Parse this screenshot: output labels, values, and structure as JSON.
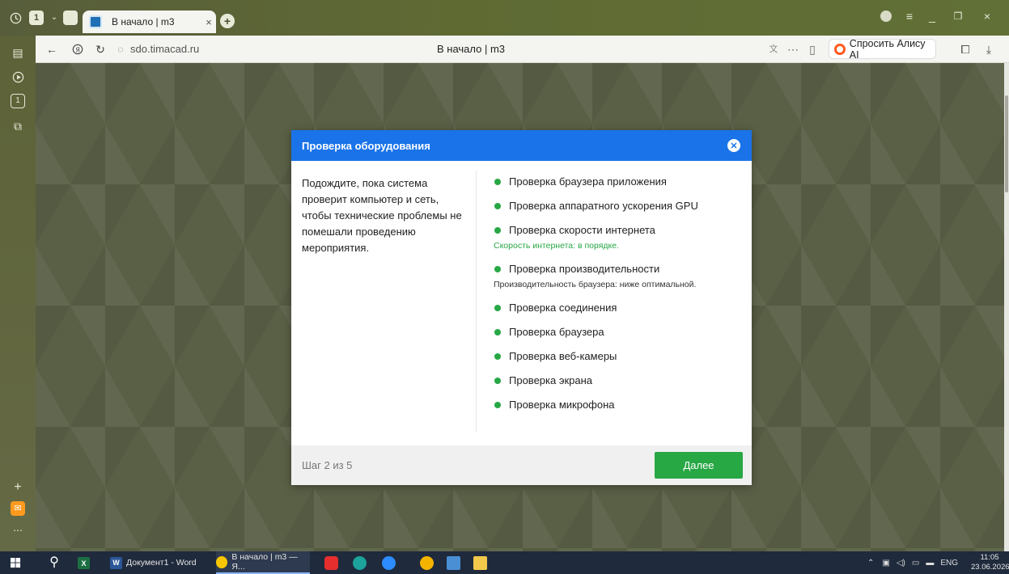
{
  "browser": {
    "tab_count": "1",
    "tab_title": "В начало | m3",
    "url": "sdo.timacad.ru",
    "page_title": "В начало | m3",
    "alice_button": "Спросить Алису AI"
  },
  "dialog": {
    "title": "Проверка оборудования",
    "description": "Подождите, пока система проверит компьютер и сеть, чтобы технические проблемы не помешали проведению мероприятия.",
    "checks": [
      {
        "name": "Проверка браузера приложения",
        "note": "",
        "status_color": "#28a745"
      },
      {
        "name": "Проверка аппаратного ускорения GPU",
        "note": "",
        "status_color": "#28a745"
      },
      {
        "name": "Проверка скорости интернета",
        "note": "Скорость интернета: в порядке.",
        "status_color": "#28a745"
      },
      {
        "name": "Проверка производительности",
        "note": "Производительность браузера: ниже оптимальной.",
        "status_color": "#28a745"
      },
      {
        "name": "Проверка соединения",
        "note": "",
        "status_color": "#28a745"
      },
      {
        "name": "Проверка браузера",
        "note": "",
        "status_color": "#28a745"
      },
      {
        "name": "Проверка веб-камеры",
        "note": "",
        "status_color": "#28a745"
      },
      {
        "name": "Проверка экрана",
        "note": "",
        "status_color": "#28a745"
      },
      {
        "name": "Проверка микрофона",
        "note": "",
        "status_color": "#28a745"
      }
    ],
    "step": "Шаг 2 из 5",
    "next_label": "Далее"
  },
  "taskbar": {
    "word_label": "Документ1 - Word",
    "browser_label": "В начало | m3 — Я...",
    "lang": "ENG",
    "time": "11:05",
    "date": "23.06.2026"
  },
  "colors": {
    "header_blue": "#1a73e8",
    "ok_green": "#28a745",
    "alice_orange": "#ff5a1f"
  }
}
